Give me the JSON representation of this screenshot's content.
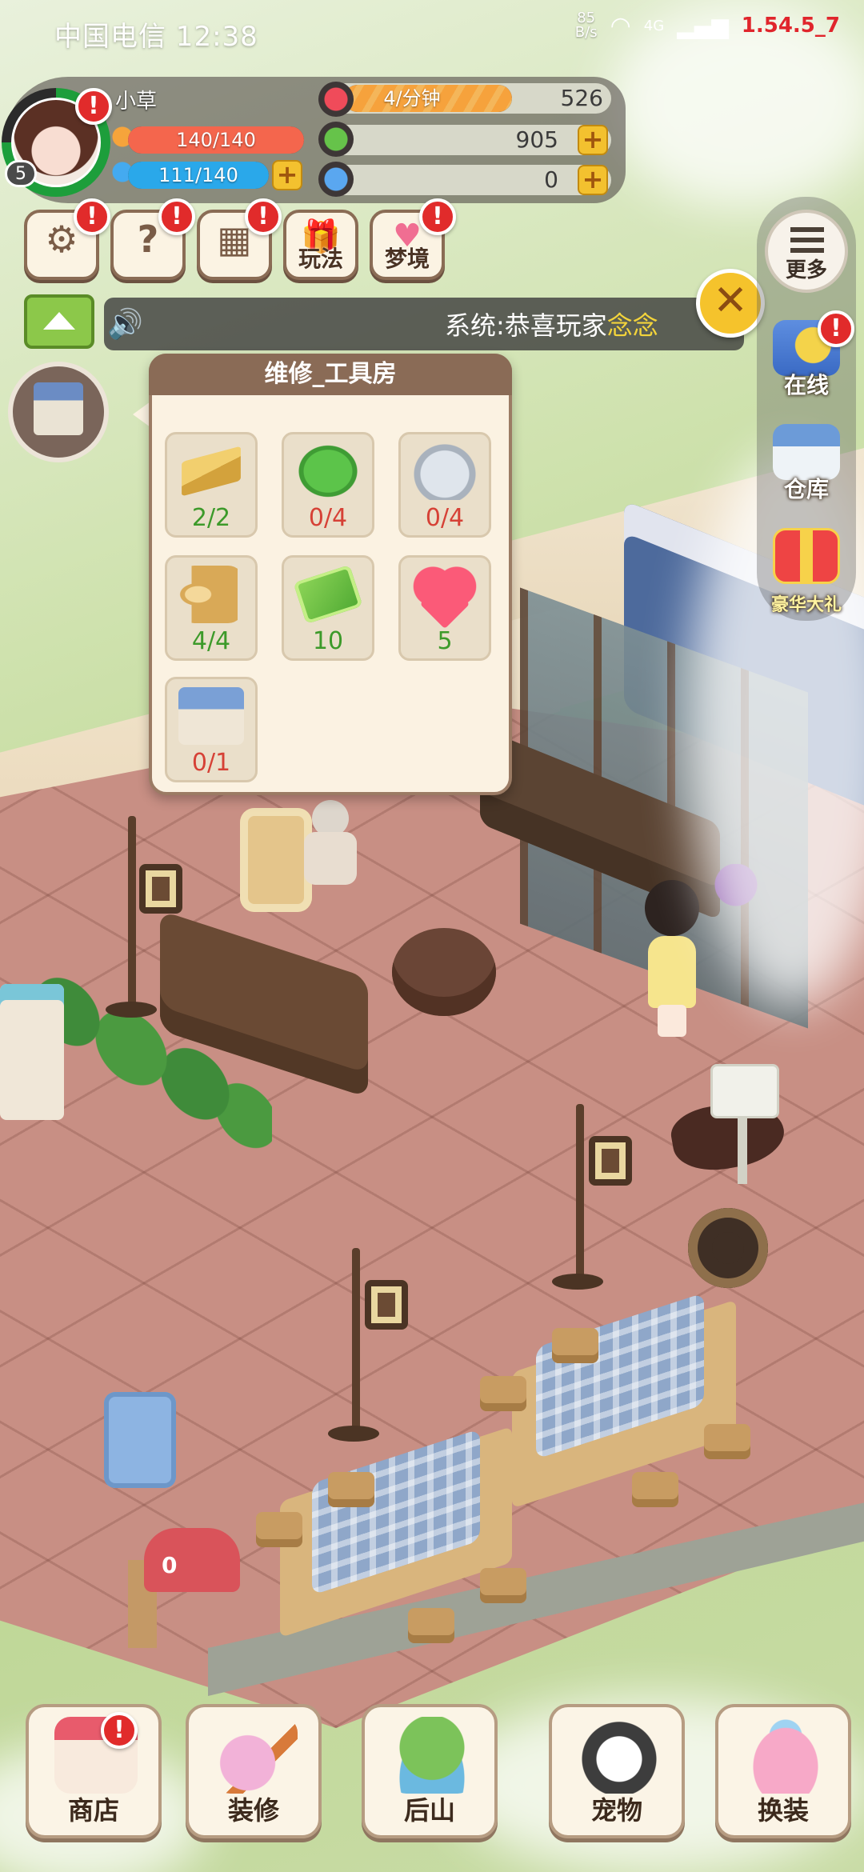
{
  "status_bar": {
    "carrier_time": "中国电信 12:38",
    "net_speed_value": "85",
    "net_speed_unit": "B/s",
    "network": "4G",
    "version": "1.54.5_7"
  },
  "player": {
    "name": "小草",
    "level": "5",
    "stamina": "140/140",
    "energy": "111/140"
  },
  "resources": {
    "rate": "4/分钟",
    "hearts": "526",
    "money": "905",
    "gems": "0"
  },
  "toolbar": {
    "play_label": "玩法",
    "dream_label": "梦境"
  },
  "announcement": {
    "text_prefix": "系统:恭喜玩家",
    "text_highlight": "念念"
  },
  "side_menu": {
    "more": "更多",
    "online": "在线",
    "warehouse": "仓库",
    "gift": "豪华大礼"
  },
  "repair_popup": {
    "title": "维修_工具房",
    "items": [
      {
        "icon": "wood-plank-icon",
        "count": "2/2",
        "status": "ok"
      },
      {
        "icon": "leaf-bundle-icon",
        "count": "0/4",
        "status": "lack"
      },
      {
        "icon": "stone-icon",
        "count": "0/4",
        "status": "lack"
      },
      {
        "icon": "log-icon",
        "count": "4/4",
        "status": "ok"
      },
      {
        "icon": "cash-icon",
        "count": "10",
        "status": "ok"
      },
      {
        "icon": "heart-icon",
        "count": "5",
        "status": "ok"
      },
      {
        "icon": "tool-house-icon",
        "count": "0/1",
        "status": "lack"
      }
    ]
  },
  "mailbox_count": "0",
  "bottom_nav": {
    "shop": "商店",
    "decorate": "装修",
    "back_hill": "后山",
    "pet": "宠物",
    "outfit": "换装"
  },
  "colors": {
    "ok_text": "#3d9a2a",
    "lack_text": "#d64136",
    "alert": "#e12b2b",
    "plus_button": "#f3c12f"
  }
}
